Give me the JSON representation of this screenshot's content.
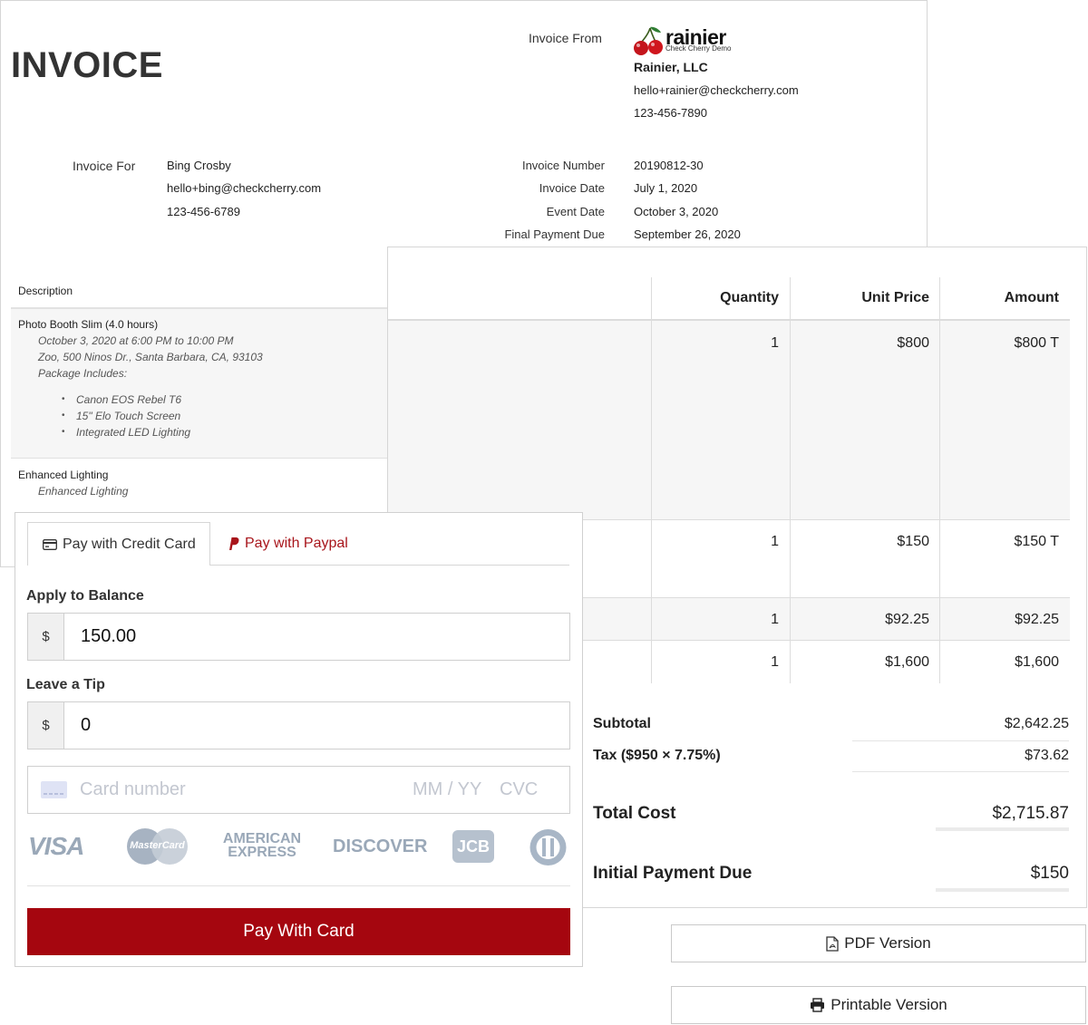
{
  "invoice": {
    "title": "INVOICE",
    "from_label": "Invoice From",
    "company": {
      "logo_text": "rainier",
      "logo_subtext": "Check Cherry Demo",
      "name": "Rainier, LLC",
      "email": "hello+rainier@checkcherry.com",
      "phone": "123-456-7890"
    },
    "for_label": "Invoice For",
    "client": {
      "name": "Bing Crosby",
      "email": "hello+bing@checkcherry.com",
      "phone": "123-456-6789"
    },
    "meta": [
      {
        "label": "Invoice Number",
        "value": "20190812-30"
      },
      {
        "label": "Invoice Date",
        "value": "July 1, 2020"
      },
      {
        "label": "Event Date",
        "value": "October 3, 2020"
      },
      {
        "label": "Final Payment Due",
        "value": "September 26, 2020"
      }
    ]
  },
  "table": {
    "headers": {
      "description": "Description",
      "quantity": "Quantity",
      "unit_price": "Unit Price",
      "amount": "Amount"
    },
    "rows": [
      {
        "title": "Photo Booth Slim (4.0 hours)",
        "details": [
          "October 3, 2020 at 6:00 PM to 10:00 PM",
          "Zoo, 500 Ninos Dr., Santa Barbara, CA, 93103",
          "Package Includes:"
        ],
        "bullets": [
          "Canon EOS Rebel T6",
          "15\" Elo Touch Screen",
          "Integrated LED Lighting"
        ],
        "quantity": "1",
        "unit_price": "$800",
        "amount": "$800 T"
      },
      {
        "title": "Enhanced Lighting",
        "details": [
          "Enhanced Lighting"
        ],
        "quantity": "1",
        "unit_price": "$150",
        "amount": "$150 T"
      },
      {
        "quantity": "1",
        "unit_price": "$92.25",
        "amount": "$92.25"
      },
      {
        "quantity": "1",
        "unit_price": "$1,600",
        "amount": "$1,600"
      }
    ]
  },
  "totals": {
    "subtotal_label": "Subtotal",
    "subtotal": "$2,642.25",
    "tax_label": "Tax ($950 × 7.75%)",
    "tax": "$73.62",
    "total_label": "Total Cost",
    "total": "$2,715.87",
    "initial_label": "Initial Payment Due",
    "initial": "$150"
  },
  "buttons": {
    "pdf": "PDF Version",
    "printable": "Printable Version"
  },
  "payment": {
    "tabs": {
      "credit_card": "Pay with Credit Card",
      "paypal": "Pay with Paypal"
    },
    "balance_label": "Apply to Balance",
    "currency": "$",
    "balance_value": "150.00",
    "tip_label": "Leave a Tip",
    "tip_value": "0",
    "card_placeholder": "Card number",
    "expiry_placeholder": "MM / YY",
    "cvc_placeholder": "CVC",
    "card_brands": [
      "VISA",
      "MasterCard",
      "AMERICAN",
      "EXPRESS",
      "DISCOVER",
      "JCB"
    ],
    "submit_label": "Pay With Card"
  },
  "colors": {
    "accent": "#a5060f",
    "paypal": "#a8151b",
    "row_bg": "#f6f6f6"
  },
  "icons": {
    "credit_card": "credit-card-icon",
    "paypal": "paypal-icon",
    "pdf": "pdf-file-icon",
    "print": "printer-icon"
  }
}
